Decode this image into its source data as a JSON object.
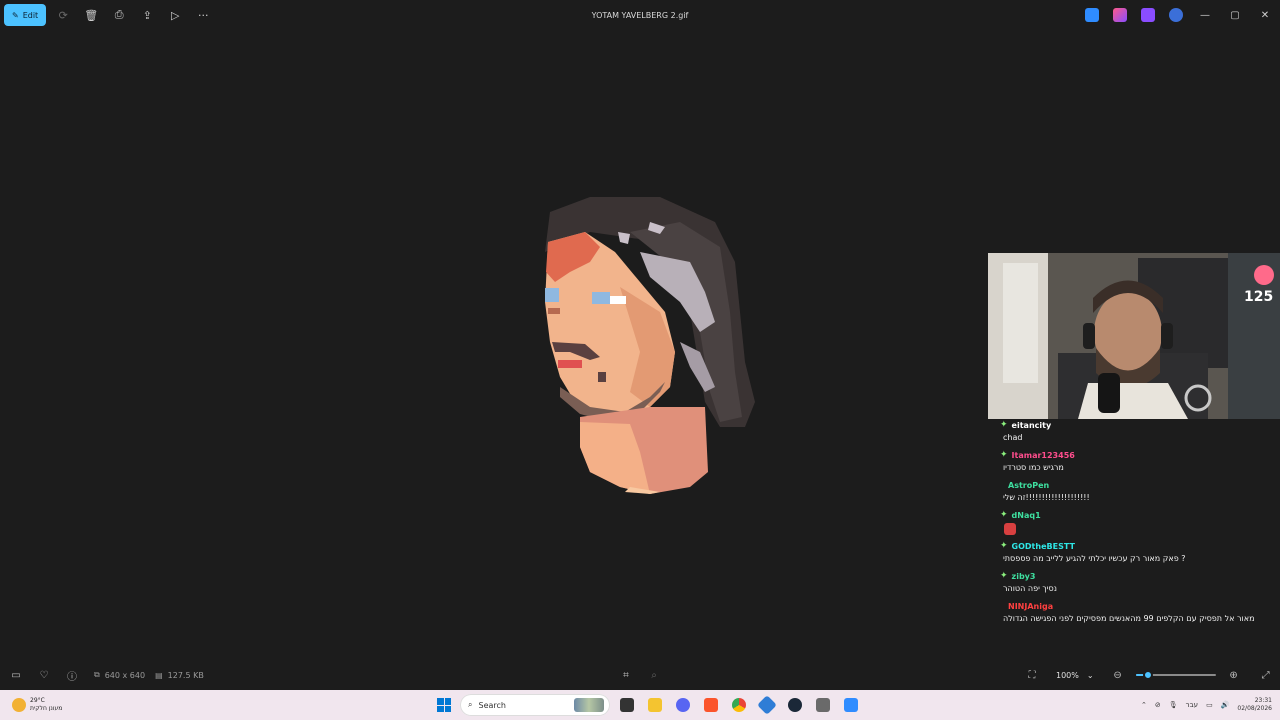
{
  "window": {
    "title": "YOTAM YAVELBERG 2.gif",
    "edit_label": "Edit"
  },
  "chat": [
    {
      "user": "eitancity",
      "color": "#ffffff",
      "badge": true,
      "text": "chad"
    },
    {
      "user": "Itamar123456",
      "color": "#ff4d8d",
      "badge": true,
      "text": "מרגיש כמו סטרדיו"
    },
    {
      "user": "AstroPen",
      "color": "#3ee0a0",
      "badge": false,
      "text": "זה שלי!!!!!!!!!!!!!!!!!!!!"
    },
    {
      "user": "dNaq1",
      "color": "#3ee0a0",
      "badge": true,
      "text": "",
      "emote": true
    },
    {
      "user": "GODtheBESTT",
      "color": "#2ee6e6",
      "badge": true,
      "text": "פאק מאור רק עכשיו יכלתי להגיע ללייב מה פספסתי ?"
    },
    {
      "user": "ziby3",
      "color": "#3ee0a0",
      "badge": true,
      "text": "נסיך יפה הטוהר"
    },
    {
      "user": "NINJAniga",
      "color": "#ff4040",
      "badge": false,
      "text": "מאור אל תפסיק עם הקלפים 99 מהאנשים מפסיקים לפני הפגישה הגדולה"
    }
  ],
  "stream_overlay": {
    "counter": "125"
  },
  "status": {
    "dimensions": "640 x 640",
    "file_size": "127.5 KB",
    "zoom": "100%",
    "zoom_fraction": 0.16
  },
  "taskbar": {
    "temperature": "29°C",
    "weather_desc": "מעונן חלקית",
    "search_label": "Search",
    "lang": "עבר",
    "time": "23:31",
    "date": "02/08/2026"
  }
}
